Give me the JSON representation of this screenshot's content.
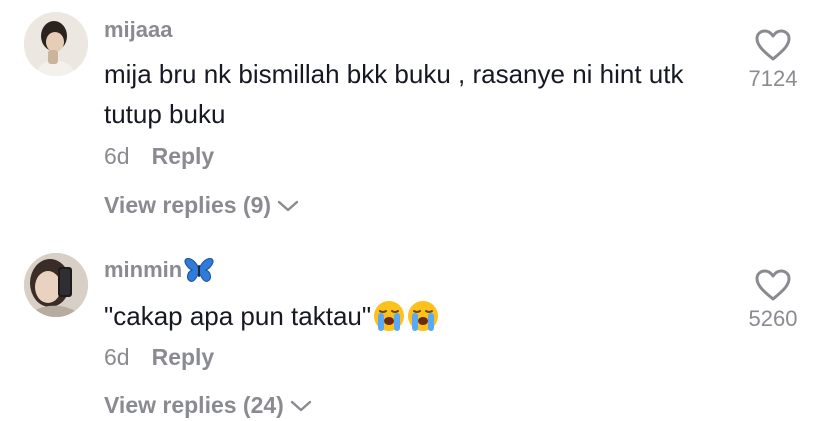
{
  "comments": [
    {
      "username": "mijaaa",
      "text": "mija bru nk bismillah bkk buku , rasanye ni hint utk tutup buku",
      "time": "6d",
      "reply_label": "Reply",
      "view_replies": "View replies (9)",
      "likes": "7124"
    },
    {
      "username": "minmin",
      "text": "\"cakap apa pun taktau\"",
      "time": "6d",
      "reply_label": "Reply",
      "view_replies": "View replies (24)",
      "likes": "5260"
    }
  ],
  "icons": {
    "like": "heart-outline-icon",
    "chevron": "chevron-down-icon",
    "butterfly": "butterfly-emoji",
    "crying": "loudly-crying-face-emoji"
  },
  "colors": {
    "secondary_text": "#8a8b91",
    "primary_text": "#161823",
    "butterfly": "#2f7bd9"
  }
}
